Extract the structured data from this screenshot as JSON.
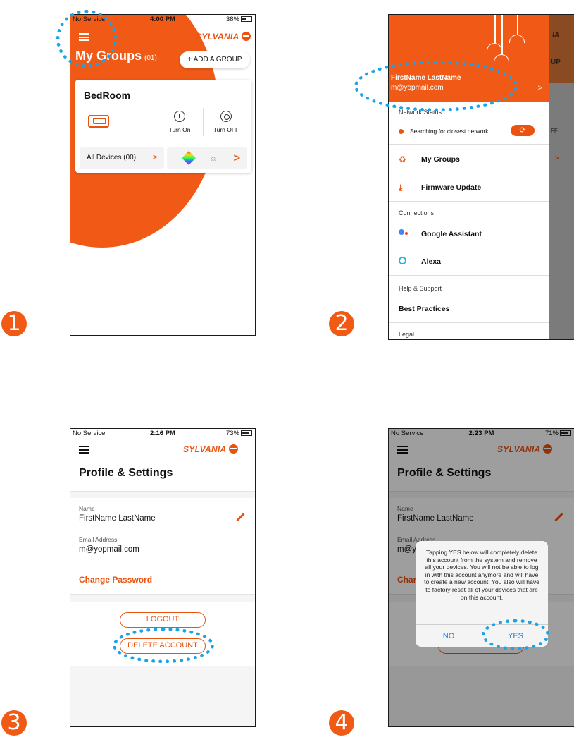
{
  "step_numbers": [
    "1",
    "2",
    "3",
    "4"
  ],
  "phone1": {
    "status": {
      "carrier": "No Service",
      "time": "4:00 PM",
      "battery": "38%"
    },
    "brand": "SYLVANIA",
    "title": "My Groups",
    "group_count": "(01)",
    "add_group_label": "+ ADD A GROUP",
    "card": {
      "title": "BedRoom",
      "turn_on": "Turn On",
      "turn_off": "Turn OFF",
      "all_devices": "All Devices (00)",
      "chevron": ">"
    }
  },
  "phone2": {
    "user_name": "FirstName LastName",
    "user_email": "m@yopmail.com",
    "chevron": ">",
    "network_status_label": "Network Status",
    "network_status_text": "Searching for closest network",
    "menu": {
      "my_groups": "My Groups",
      "firmware_update": "Firmware Update",
      "connections_label": "Connections",
      "google_assistant": "Google Assistant",
      "alexa": "Alexa",
      "help_label": "Help & Support",
      "best_practices": "Best Practices",
      "legal_label": "Legal"
    },
    "background_fragments": {
      "brand_tail": "IA",
      "button_tail": "UP",
      "off_tail": "FF",
      "chevron": ">"
    }
  },
  "phone3": {
    "status": {
      "carrier": "No Service",
      "time": "2:16 PM",
      "battery": "73%"
    },
    "brand": "SYLVANIA",
    "title": "Profile & Settings",
    "name_label": "Name",
    "name_value": "FirstName LastName",
    "email_label": "Email Address",
    "email_value": "m@yopmail.com",
    "change_password": "Change Password",
    "logout": "LOGOUT",
    "delete_account": "DELETE ACCOUNT"
  },
  "phone4": {
    "status": {
      "carrier": "No Service",
      "time": "2:23 PM",
      "battery": "71%"
    },
    "brand": "SYLVANIA",
    "title": "Profile & Settings",
    "name_label": "Name",
    "name_value": "FirstName LastName",
    "email_label_partial": "Email Address",
    "email_value_partial": "m@y",
    "change_password_partial": "Char",
    "delete_account_partial": "DELETE ACCOUNT",
    "dialog": {
      "message": "Tapping YES below will completely delete this account from the system and remove all your devices. You will not be able to log in with this account anymore and will have to create a new account. You also will have to factory reset all of your devices that are on this account.",
      "no": "NO",
      "yes": "YES"
    }
  },
  "colors": {
    "accent": "#f15a16",
    "highlight": "#1aa3e8",
    "link_blue": "#1a7ee8"
  }
}
